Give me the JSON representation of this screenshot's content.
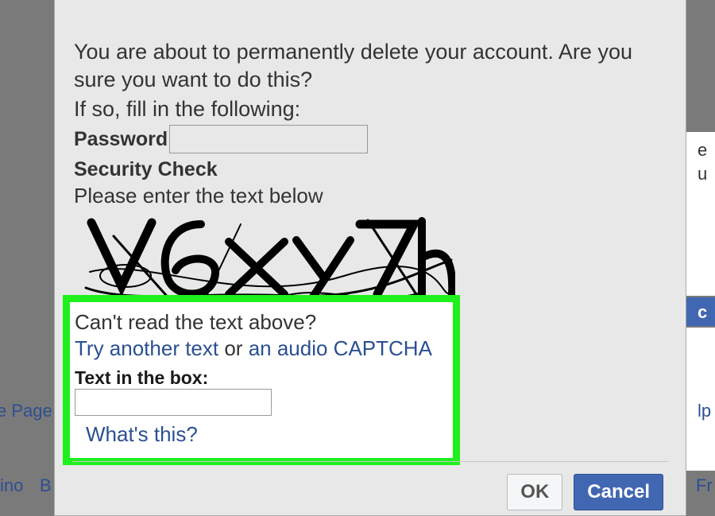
{
  "background": {
    "link_page": "e Page",
    "link_ino": "ino",
    "link_b": "B",
    "right_et": "e",
    "right_bu": "u",
    "right_co": "c",
    "right_lp": "lp",
    "right_fr": "Fr"
  },
  "dialog": {
    "warning": "You are about to permanently delete your account. Are you sure you want to do this?",
    "fill_prompt": "If so, fill in the following:",
    "password_label": "Password",
    "security_heading": "Security Check",
    "please_enter": "Please enter the text below",
    "captcha_value": "V6xy7h"
  },
  "captcha_box": {
    "cant_read": "Can't read the text above?",
    "try_text": "Try another text",
    "or": " or ",
    "audio": "an audio CAPTCHA",
    "text_in_box": "Text in the box:",
    "whats_this": "What's this?"
  },
  "buttons": {
    "ok": "OK",
    "cancel": "Cancel"
  }
}
